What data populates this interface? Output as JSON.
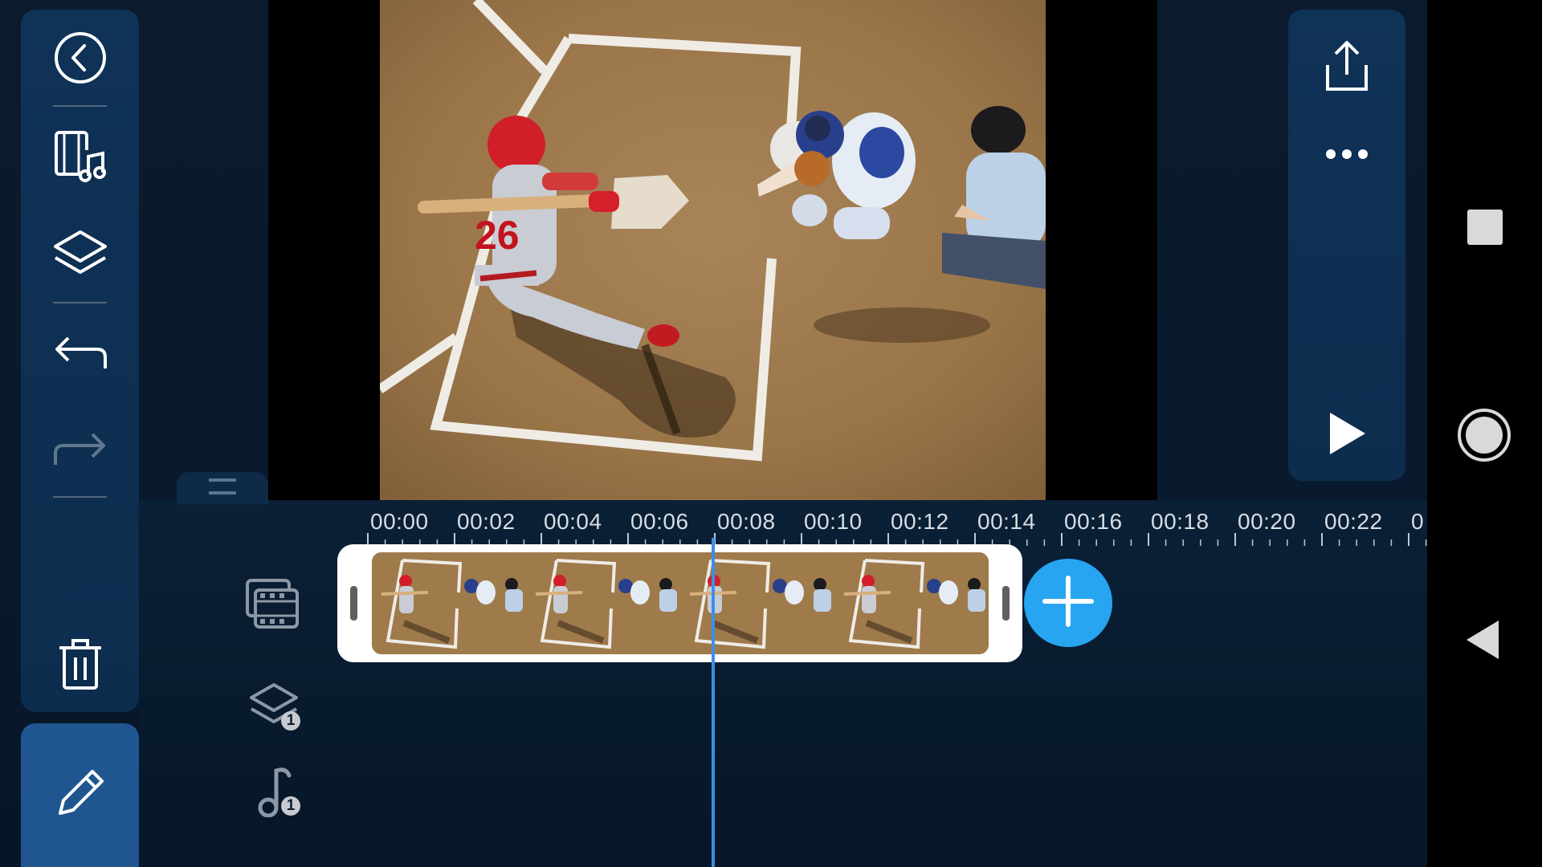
{
  "left_toolbar": {
    "back": {
      "icon": "back-circle-icon"
    },
    "media": {
      "icon": "media-library-icon"
    },
    "layers": {
      "icon": "layers-icon"
    },
    "undo": {
      "icon": "undo-icon"
    },
    "redo": {
      "icon": "redo-icon",
      "enabled": false
    },
    "delete": {
      "icon": "trash-icon"
    },
    "edit": {
      "icon": "pencil-icon",
      "selected": true
    }
  },
  "right_toolbar": {
    "export": {
      "icon": "share-upload-icon"
    },
    "more": {
      "icon": "more-dots-icon"
    },
    "play": {
      "icon": "play-icon"
    }
  },
  "system_nav": {
    "recents": {
      "icon": "square-icon"
    },
    "home": {
      "icon": "circle-home-icon"
    },
    "back": {
      "icon": "triangle-back-icon"
    }
  },
  "timeline": {
    "ruler_labels": [
      "00:00",
      "00:02",
      "00:04",
      "00:06",
      "00:08",
      "00:10",
      "00:12",
      "00:14",
      "00:16",
      "00:18",
      "00:20",
      "00:22",
      "0"
    ],
    "tracks": {
      "video": {
        "icon": "film-strip-icon"
      },
      "layers": {
        "icon": "layer-stack-icon",
        "count": "1"
      },
      "audio": {
        "icon": "music-note-icon",
        "count": "1"
      }
    },
    "add_clip": {
      "icon": "plus-icon"
    }
  },
  "colors": {
    "accent": "#27a5f0",
    "playhead": "#3a8fe8",
    "rail": "#0f3257",
    "selected": "#1f5690",
    "background": "#0b1a2c"
  }
}
